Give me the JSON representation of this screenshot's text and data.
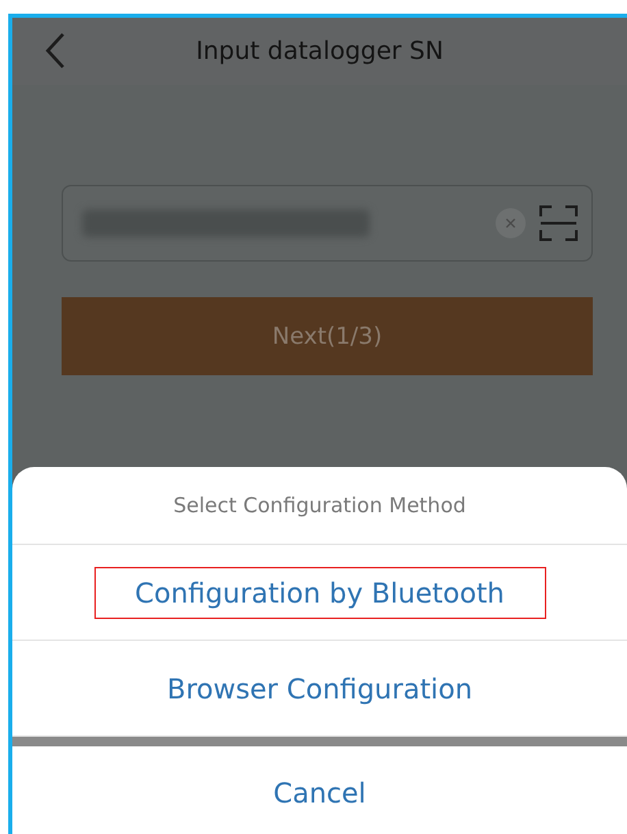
{
  "header": {
    "title": "Input datalogger SN"
  },
  "sn_field": {
    "value_redacted": true
  },
  "next_button": {
    "label": "Next(1/3)"
  },
  "sheet": {
    "title": "Select Configuration Method",
    "options": [
      {
        "label": "Configuration by Bluetooth",
        "highlighted": true
      },
      {
        "label": "Browser Configuration",
        "highlighted": false
      }
    ],
    "cancel": "Cancel"
  }
}
